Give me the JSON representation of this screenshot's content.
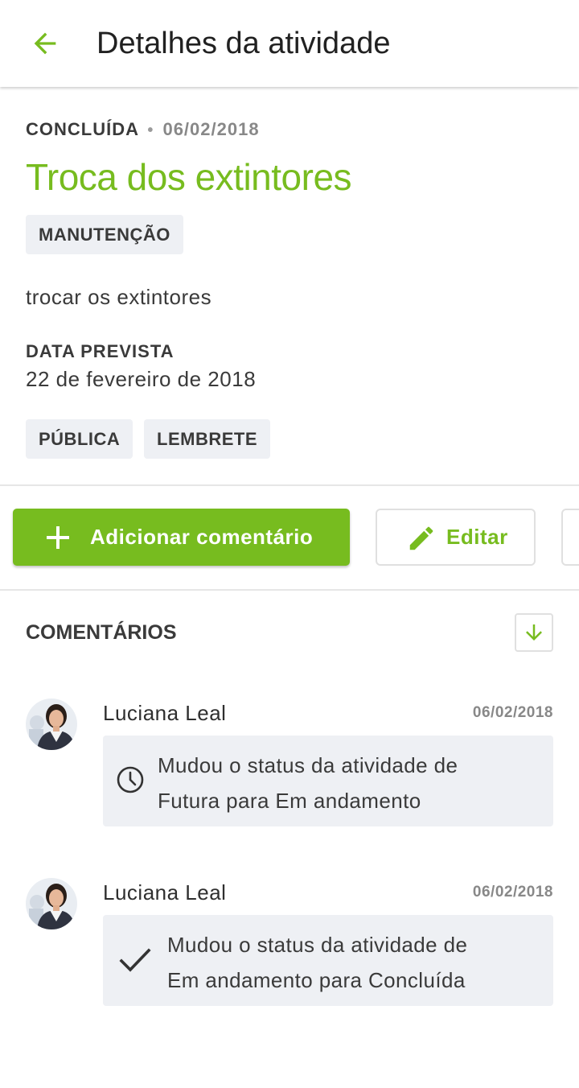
{
  "appbar": {
    "title": "Detalhes da atividade",
    "back_icon": "arrow-left-icon",
    "accent_color": "#77bc1f"
  },
  "activity": {
    "status": "CONCLUÍDA",
    "separator": "•",
    "status_date": "06/02/2018",
    "title": "Troca dos extintores",
    "category": "MANUTENÇÃO",
    "description": "trocar os extintores",
    "due_label": "DATA PREVISTA",
    "due_value": "22 de fevereiro de 2018",
    "tags": [
      "PÚBLICA",
      "LEMBRETE"
    ]
  },
  "actions": {
    "add_comment": {
      "label": "Adicionar comentário",
      "icon": "plus-icon"
    },
    "edit": {
      "label": "Editar",
      "icon": "pencil-icon"
    }
  },
  "comments": {
    "title": "COMENTÁRIOS",
    "sort_icon": "arrow-down-icon",
    "items": [
      {
        "author": "Luciana Leal",
        "date": "06/02/2018",
        "icon": "clock-icon",
        "text_line1": "Mudou o status da atividade de",
        "text_line2": "Futura para Em andamento"
      },
      {
        "author": "Luciana Leal",
        "date": "06/02/2018",
        "icon": "check-icon",
        "text_line1": "Mudou o status da atividade de",
        "text_line2": "Em andamento para Concluída"
      }
    ]
  }
}
